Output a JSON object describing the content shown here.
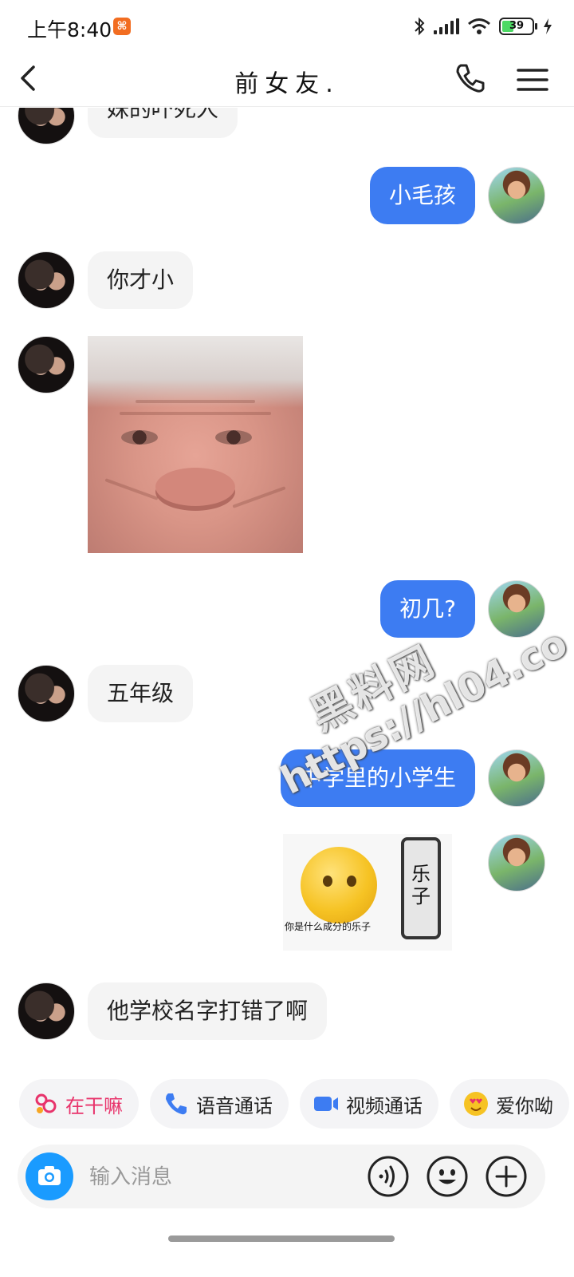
{
  "status_bar": {
    "time": "上午8:40",
    "battery": "39"
  },
  "header": {
    "title": "前女友."
  },
  "messages": [
    {
      "side": "in",
      "text": "妹的吓死人"
    },
    {
      "side": "out",
      "text": "小毛孩"
    },
    {
      "side": "in",
      "text": "你才小"
    },
    {
      "side": "in",
      "image": "old-face-meme"
    },
    {
      "side": "out",
      "text": "初几?"
    },
    {
      "side": "in",
      "text": "五年级"
    },
    {
      "side": "out",
      "text": "中学里的小学生"
    },
    {
      "side": "out",
      "image": "emoji-phone-meme",
      "phone_text": "乐子",
      "caption": "你是什么成分的乐子"
    },
    {
      "side": "in",
      "text": "他学校名字打错了啊"
    }
  ],
  "watermark": {
    "line1": "黑料网",
    "line2": "https://hl04.co"
  },
  "quick_actions": [
    {
      "label": "在干嘛",
      "icon": "sparkle-icon",
      "color": "#e8336b"
    },
    {
      "label": "语音通话",
      "icon": "phone-icon",
      "color": "#3d7cf2"
    },
    {
      "label": "视频通话",
      "icon": "video-icon",
      "color": "#3d7cf2"
    },
    {
      "label": "爱你呦",
      "icon": "heart-eyes-icon",
      "color": "#f6c324"
    }
  ],
  "input": {
    "placeholder": "输入消息"
  }
}
